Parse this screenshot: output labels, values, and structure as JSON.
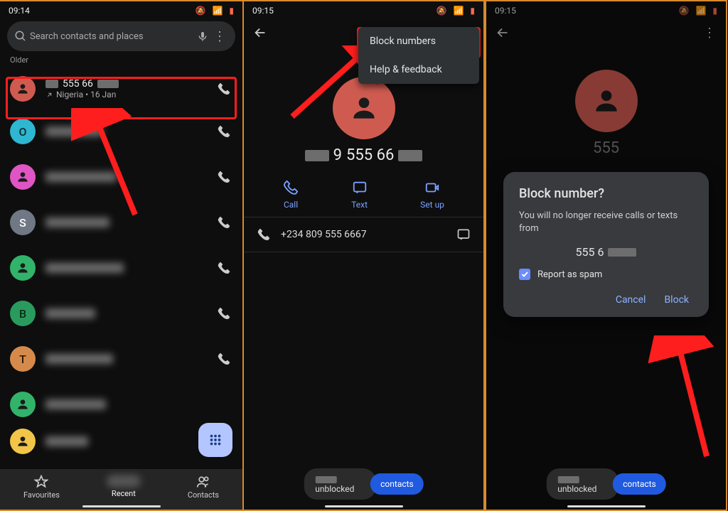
{
  "panel1": {
    "time": "09:14",
    "search_placeholder": "Search contacts and places",
    "section_label": "Older",
    "first_row": {
      "number_fragment": "555 66",
      "subline": "Nigeria • 16 Jan"
    },
    "avatars": [
      "O",
      "",
      "S",
      "",
      "B",
      "T",
      "",
      ""
    ],
    "bottom": {
      "fav": "Favourites",
      "recent": "Recent",
      "contacts": "Contacts"
    }
  },
  "panel2": {
    "time": "09:15",
    "menu": {
      "block": "Block numbers",
      "help": "Help & feedback"
    },
    "num_fragment": "555 66",
    "actions": {
      "call": "Call",
      "text": "Text",
      "setup": "Set up"
    },
    "detail_number": "+234 809 555 6667",
    "toast": {
      "msg": "unblocked",
      "pill": "contacts"
    }
  },
  "panel3": {
    "time": "09:15",
    "num_prefix": "555",
    "dialog": {
      "title": "Block number?",
      "body": "You will no longer receive calls or texts from",
      "num_fragment": "555 6",
      "spam": "Report as spam",
      "cancel": "Cancel",
      "block": "Block"
    },
    "toast": {
      "msg": "unblocked",
      "pill": "contacts"
    }
  }
}
